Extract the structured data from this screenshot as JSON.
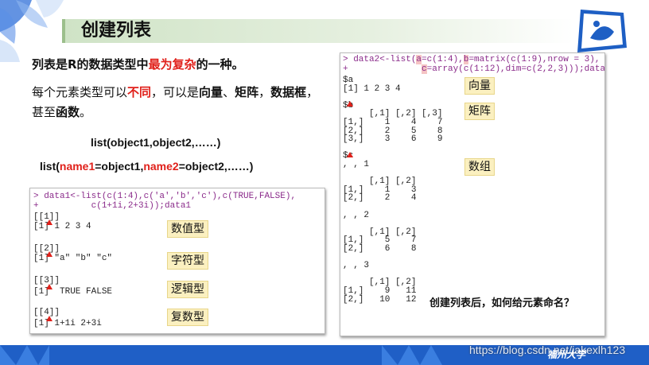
{
  "slide": {
    "title": "创建列表",
    "intro": {
      "a": "列表是R的数据类型中",
      "b": "最为复杂",
      "c": "的一种。"
    },
    "para": {
      "a": "每个元素类型可以",
      "b": "不同",
      "c": "，可以是",
      "d": "向量",
      "e": "、",
      "f": "矩阵",
      "g": "，",
      "h": "数据框",
      "i": "，甚至",
      "j": "函数",
      "k": "。"
    },
    "syntax1": "list(object1,object2,……)",
    "syntax2": {
      "a": "list(",
      "b": "name1",
      "c": "=object1,",
      "d": "name2",
      "e": "=object2,……)"
    },
    "question": "创建列表后，如何给元素命名？",
    "watermark": "https://blog.csdn.net/jakexlh123",
    "school": "福州大学"
  },
  "code1": {
    "cmd1": "> data1<-list(c(1:4),c('a','b','c'),c(TRUE,FALSE),",
    "cmd2": "+          c(1+1i,2+3i));data1",
    "out": [
      "[[1]]",
      "[1] 1 2 3 4",
      "",
      "[[2]]",
      "[1] \"a\" \"b\" \"c\"",
      "",
      "[[3]]",
      "[1]  TRUE FALSE",
      "",
      "[[4]]",
      "[1] 1+1i 2+3i"
    ],
    "tags": [
      "数值型",
      "字符型",
      "逻辑型",
      "复数型"
    ]
  },
  "code2": {
    "cmd1a": "> data2<-list(",
    "cmd1b": "a",
    "cmd1c": "=c(1:4),",
    "cmd1d": "b",
    "cmd1e": "=matrix(c(1:9),nrow = 3),",
    "cmd2a": "+              ",
    "cmd2b": "c",
    "cmd2c": "=array(c(1:12),dim=c(2,2,3)));data2",
    "out": [
      "$a",
      "[1] 1 2 3 4",
      "",
      "$b",
      "     [,1] [,2] [,3]",
      "[1,]    1    4    7",
      "[2,]    2    5    8",
      "[3,]    3    6    9",
      "",
      "$c",
      ", , 1",
      "",
      "     [,1] [,2]",
      "[1,]    1    3",
      "[2,]    2    4",
      "",
      ", , 2",
      "",
      "     [,1] [,2]",
      "[1,]    5    7",
      "[2,]    6    8",
      "",
      ", , 3",
      "",
      "     [,1] [,2]",
      "[1,]    9   11",
      "[2,]   10   12"
    ],
    "tags": [
      "向量",
      "矩阵",
      "数组"
    ]
  }
}
